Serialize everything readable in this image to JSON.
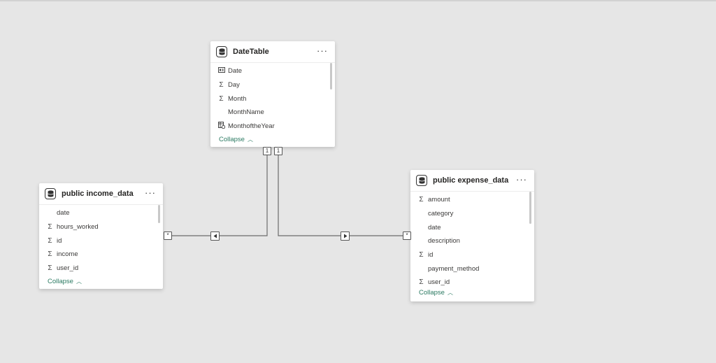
{
  "canvas": {
    "background": "#e6e6e6",
    "accent": "#2b7a62"
  },
  "tables": {
    "date_table": {
      "title": "DateTable",
      "more": "···",
      "fields": [
        {
          "name": "Date",
          "icon": "calendar-table-icon"
        },
        {
          "name": "Day",
          "icon": "sigma-icon"
        },
        {
          "name": "Month",
          "icon": "sigma-icon"
        },
        {
          "name": "MonthName",
          "icon": ""
        },
        {
          "name": "MonthoftheYear",
          "icon": "calculated-column-icon"
        }
      ],
      "collapse": "Collapse"
    },
    "income": {
      "title": "public income_data",
      "more": "···",
      "fields": [
        {
          "name": "date",
          "icon": ""
        },
        {
          "name": "hours_worked",
          "icon": "sigma-icon"
        },
        {
          "name": "id",
          "icon": "sigma-icon"
        },
        {
          "name": "income",
          "icon": "sigma-icon"
        },
        {
          "name": "user_id",
          "icon": "sigma-icon"
        }
      ],
      "collapse": "Collapse"
    },
    "expense": {
      "title": "public expense_data",
      "more": "···",
      "fields": [
        {
          "name": "amount",
          "icon": "sigma-icon"
        },
        {
          "name": "category",
          "icon": ""
        },
        {
          "name": "date",
          "icon": ""
        },
        {
          "name": "description",
          "icon": ""
        },
        {
          "name": "id",
          "icon": "sigma-icon"
        },
        {
          "name": "payment_method",
          "icon": ""
        },
        {
          "name": "user_id",
          "icon": "sigma-icon"
        }
      ],
      "collapse": "Collapse"
    }
  },
  "relationships": {
    "date_to_income": {
      "one_side": "1",
      "many_side": "*"
    },
    "date_to_expense": {
      "one_side": "1",
      "many_side": "*"
    }
  }
}
